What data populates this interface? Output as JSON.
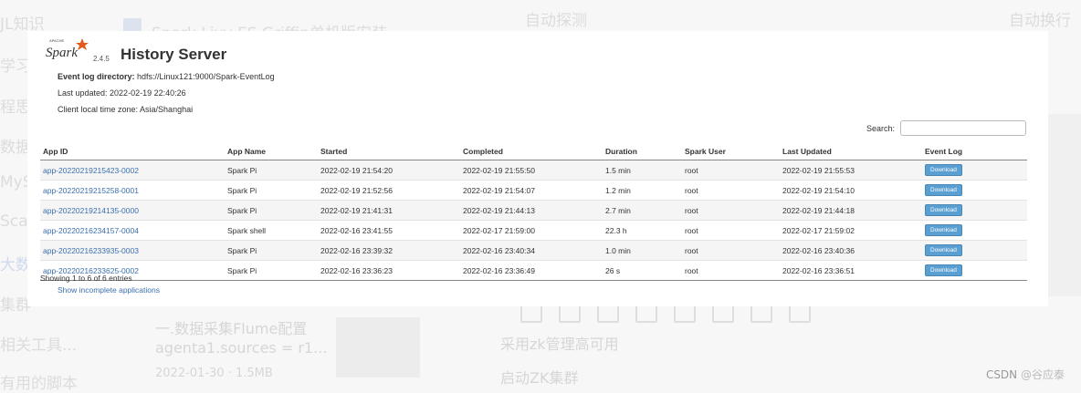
{
  "background": {
    "sidebar": [
      "JL知识",
      "学习",
      "程思想",
      "数据",
      "MySc",
      "Scala",
      "大数据",
      "集群",
      "相关工具...",
      "有用的脚本"
    ],
    "article_title": "Spark Livy ES Griffin单机版安装",
    "toolbar_left": "自动探测",
    "toolbar_right": "自动换行",
    "card_title": "一.数据采集Flume配置",
    "card_snippet": "agenta1.sources = r1...",
    "card_meta": "2022-01-30  ·  1.5MB",
    "right_item1": "采用zk管理高可用",
    "right_item2": "启动ZK集群",
    "watermark_prefix": "CSDN",
    "watermark_user": "@谷应泰"
  },
  "app": {
    "logo_text": "Spark",
    "logo_sub": "APACHE",
    "version": "2.4.5",
    "title": "History Server",
    "event_log_label": "Event log directory:",
    "event_log_value": "hdfs://Linux121:9000/Spark-EventLog",
    "last_updated": "Last updated: 2022-02-19 22:40:26",
    "timezone": "Client local time zone: Asia/Shanghai",
    "search_label": "Search:",
    "search_value": "",
    "showing": "Showing 1 to 6 of 6 entries",
    "show_incomplete": "Show incomplete applications",
    "columns": [
      "App ID",
      "App Name",
      "Started",
      "Completed",
      "Duration",
      "Spark User",
      "Last Updated",
      "Event Log"
    ],
    "download_label": "Download",
    "rows": [
      {
        "id": "app-20220219215423-0002",
        "name": "Spark Pi",
        "started": "2022-02-19 21:54:20",
        "completed": "2022-02-19 21:55:50",
        "duration": "1.5 min",
        "user": "root",
        "updated": "2022-02-19 21:55:53"
      },
      {
        "id": "app-20220219215258-0001",
        "name": "Spark Pi",
        "started": "2022-02-19 21:52:56",
        "completed": "2022-02-19 21:54:07",
        "duration": "1.2 min",
        "user": "root",
        "updated": "2022-02-19 21:54:10"
      },
      {
        "id": "app-20220219214135-0000",
        "name": "Spark Pi",
        "started": "2022-02-19 21:41:31",
        "completed": "2022-02-19 21:44:13",
        "duration": "2.7 min",
        "user": "root",
        "updated": "2022-02-19 21:44:18"
      },
      {
        "id": "app-20220216234157-0004",
        "name": "Spark shell",
        "started": "2022-02-16 23:41:55",
        "completed": "2022-02-17 21:59:00",
        "duration": "22.3 h",
        "user": "root",
        "updated": "2022-02-17 21:59:02"
      },
      {
        "id": "app-20220216233935-0003",
        "name": "Spark Pi",
        "started": "2022-02-16 23:39:32",
        "completed": "2022-02-16 23:40:34",
        "duration": "1.0 min",
        "user": "root",
        "updated": "2022-02-16 23:40:36"
      },
      {
        "id": "app-20220216233625-0002",
        "name": "Spark Pi",
        "started": "2022-02-16 23:36:23",
        "completed": "2022-02-16 23:36:49",
        "duration": "26 s",
        "user": "root",
        "updated": "2022-02-16 23:36:51"
      }
    ]
  }
}
